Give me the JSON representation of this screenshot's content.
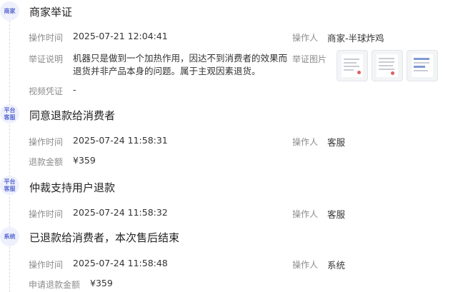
{
  "events": [
    {
      "badge": "商家",
      "title": "商家举证",
      "time_label": "操作时间",
      "time": "2025-07-21 12:04:41",
      "operator_label": "操作人",
      "operator": "商家-半球炸鸡",
      "description_label": "举证说明",
      "description": "机器只是做到一个加热作用，因达不到消费者的效果而退货并非产品本身的问题。属于主观因素退货。",
      "evidence_label": "举证图片",
      "voucher_label": "视频凭证",
      "voucher": "-"
    },
    {
      "badge": "平台客服",
      "title": "同意退款给消费者",
      "time_label": "操作时间",
      "time": "2025-07-24 11:58:31",
      "operator_label": "操作人",
      "operator": "客服",
      "amount_label": "退款金额",
      "amount": "¥359"
    },
    {
      "badge": "平台客服",
      "title": "仲裁支持用户退款",
      "time_label": "操作时间",
      "time": "2025-07-24 11:58:32",
      "operator_label": "操作人",
      "operator": "客服"
    },
    {
      "badge": "系统",
      "title": "已退款给消费者，本次售后结束",
      "time_label": "操作时间",
      "time": "2025-07-24 11:58:48",
      "operator_label": "操作人",
      "operator": "系统",
      "amount_label": "申请退款金额",
      "amount": "¥359"
    }
  ],
  "colors": {
    "accent": "#5b6bd4",
    "badge_bg": "#eef0fb",
    "label": "#8c8c8c"
  },
  "icons": {
    "evidence_thumb": "document-image-icon"
  }
}
